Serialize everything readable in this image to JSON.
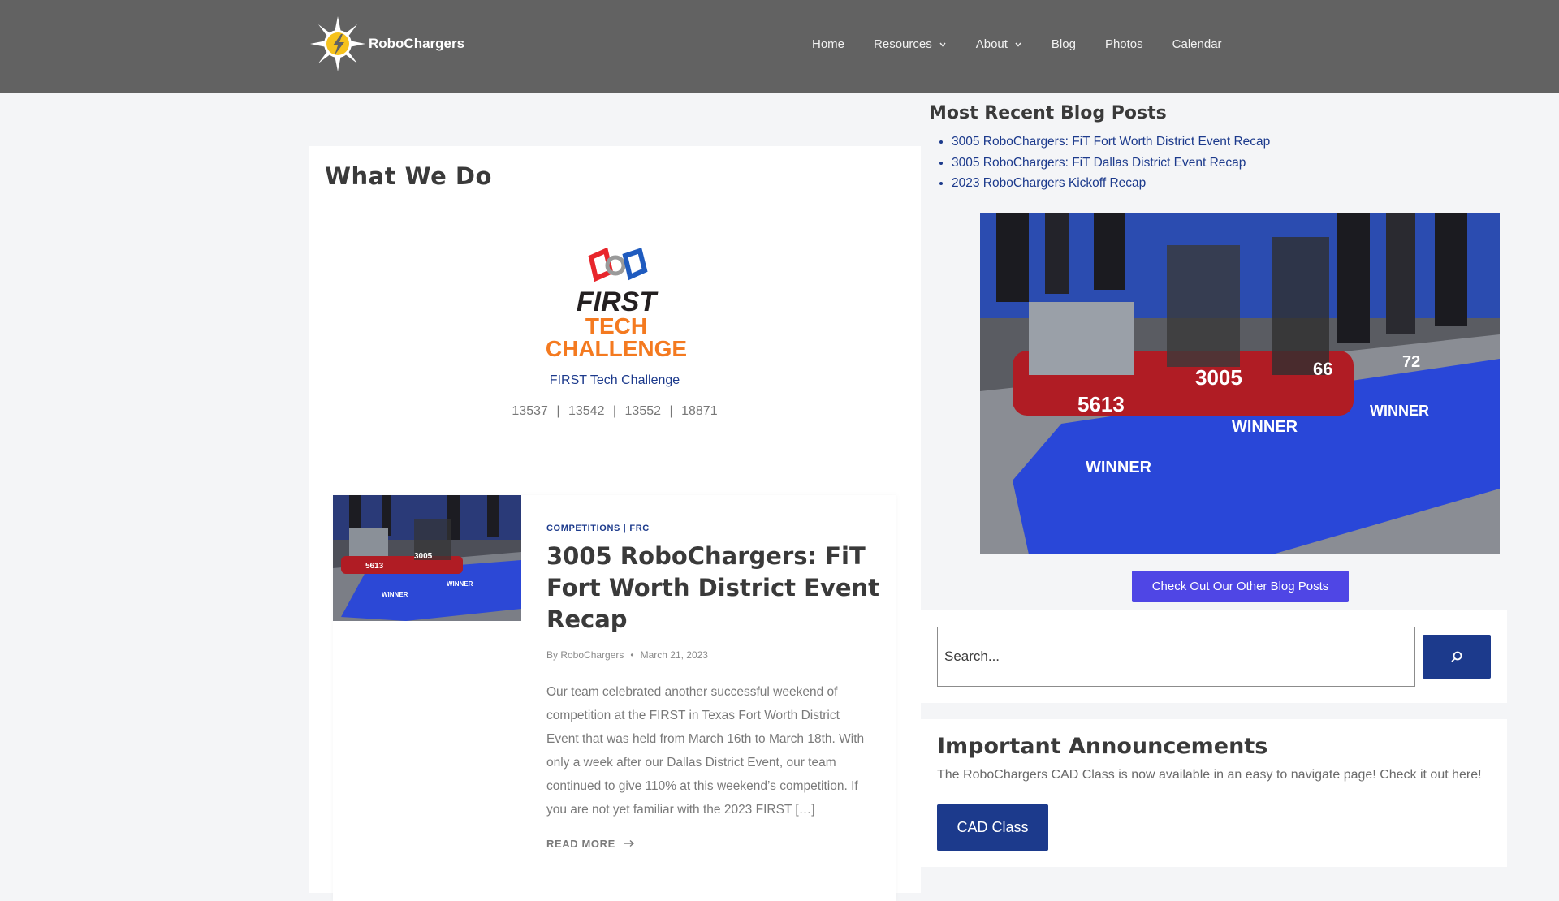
{
  "header": {
    "brand": "RoboChargers",
    "nav": [
      {
        "label": "Home",
        "dropdown": false
      },
      {
        "label": "Resources",
        "dropdown": true
      },
      {
        "label": "About",
        "dropdown": true
      },
      {
        "label": "Blog",
        "dropdown": false
      },
      {
        "label": "Photos",
        "dropdown": false
      },
      {
        "label": "Calendar",
        "dropdown": false
      }
    ]
  },
  "main": {
    "title": "What We Do",
    "ftc_logo_text": {
      "line1": "FIRST",
      "line2": "TECH",
      "line3": "CHALLENGE"
    },
    "ftc_caption": "FIRST Tech Challenge",
    "teams": [
      "13537",
      "13542",
      "13552",
      "18871"
    ],
    "post": {
      "categories": [
        "COMPETITIONS",
        "FRC"
      ],
      "category_sep": "|",
      "title": "3005 RoboChargers: FiT Fort Worth District Event Recap",
      "author": "By RoboChargers",
      "date": "March 21, 2023",
      "excerpt": "Our team celebrated another successful weekend of competition at the FIRST in Texas Fort Worth District Event that was held from March 16th to March 18th.  With only a week after our Dallas District Event, our team continued to give 110% at this weekend’s competition.  If you are not yet familiar with the 2023 FIRST […]",
      "read_more": "READ MORE"
    }
  },
  "sidebar": {
    "recent_title": "Most Recent Blog Posts",
    "recent_posts": [
      "3005 RoboChargers: FiT Fort Worth District Event Recap",
      "3005 RoboChargers: FiT Dallas District Event Recap",
      "2023 RoboChargers Kickoff Recap"
    ],
    "cta_label": "Check Out Our Other Blog Posts",
    "search_placeholder": "Search...",
    "announcements": {
      "title": "Important Announcements",
      "text": "The RoboChargers CAD Class is now available in an easy to navigate page! Check it out here!",
      "button": "CAD Class"
    }
  },
  "colors": {
    "header_bg": "#626262",
    "link": "#1c3a8c",
    "cta": "#4f46e5",
    "primary_button": "#1c3a8c",
    "ftc_orange": "#f47a20",
    "ftc_blue": "#1f5bbf",
    "ftc_red": "#e8262c"
  }
}
